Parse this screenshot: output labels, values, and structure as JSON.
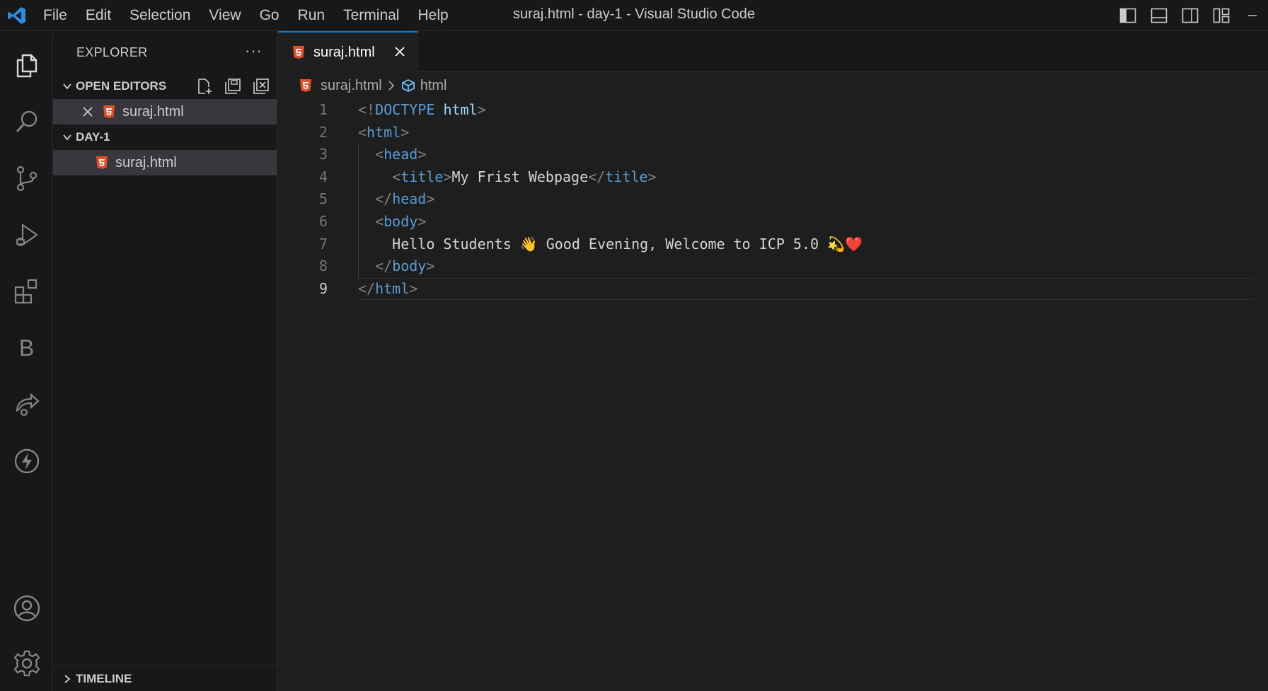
{
  "window": {
    "title": "suraj.html - day-1 - Visual Studio Code"
  },
  "menu": [
    "File",
    "Edit",
    "Selection",
    "View",
    "Go",
    "Run",
    "Terminal",
    "Help"
  ],
  "colors": {
    "accent": "#0078d4",
    "html_icon": "#e44d26",
    "tag": "#569cd6",
    "bracket": "#808080",
    "text": "#d4d4d4"
  },
  "activity_bar": {
    "top": [
      "files-icon",
      "search-icon",
      "source-control-icon",
      "run-debug-icon",
      "extensions-icon",
      "b-extension-icon",
      "live-share-icon",
      "thunder-client-icon"
    ],
    "bottom": [
      "account-icon",
      "settings-gear-icon"
    ],
    "b_label": "B"
  },
  "sidebar": {
    "title": "EXPLORER",
    "more": "···",
    "open_editors": {
      "label": "OPEN EDITORS",
      "items": [
        {
          "name": "suraj.html"
        }
      ]
    },
    "folder": {
      "label": "DAY-1",
      "items": [
        {
          "name": "suraj.html"
        }
      ]
    },
    "timeline": {
      "label": "TIMELINE"
    }
  },
  "editor": {
    "tab": {
      "label": "suraj.html"
    },
    "breadcrumb": {
      "file": "suraj.html",
      "symbol": "html"
    },
    "active_line": 9,
    "lines": [
      {
        "num": "1",
        "parts": [
          [
            "p",
            "<!"
          ],
          [
            "k",
            "DOCTYPE"
          ],
          [
            "w",
            " "
          ],
          [
            "a",
            "html"
          ],
          [
            "p",
            ">"
          ]
        ]
      },
      {
        "num": "2",
        "parts": [
          [
            "p",
            "<"
          ],
          [
            "t",
            "html"
          ],
          [
            "p",
            ">"
          ]
        ]
      },
      {
        "num": "3",
        "parts": [
          [
            "w",
            "  "
          ],
          [
            "p",
            "<"
          ],
          [
            "t",
            "head"
          ],
          [
            "p",
            ">"
          ]
        ]
      },
      {
        "num": "4",
        "parts": [
          [
            "w",
            "    "
          ],
          [
            "p",
            "<"
          ],
          [
            "t",
            "title"
          ],
          [
            "p",
            ">"
          ],
          [
            "w",
            "My Frist Webpage"
          ],
          [
            "p",
            "</"
          ],
          [
            "t",
            "title"
          ],
          [
            "p",
            ">"
          ]
        ]
      },
      {
        "num": "5",
        "parts": [
          [
            "w",
            "  "
          ],
          [
            "p",
            "</"
          ],
          [
            "t",
            "head"
          ],
          [
            "p",
            ">"
          ]
        ]
      },
      {
        "num": "6",
        "parts": [
          [
            "w",
            "  "
          ],
          [
            "p",
            "<"
          ],
          [
            "t",
            "body"
          ],
          [
            "p",
            ">"
          ]
        ]
      },
      {
        "num": "7",
        "parts": [
          [
            "w",
            "    Hello Students "
          ],
          [
            "e",
            "👋"
          ],
          [
            "w",
            " Good Evening, Welcome to ICP 5.0 "
          ],
          [
            "e",
            "💫"
          ],
          [
            "e",
            "❤️"
          ]
        ]
      },
      {
        "num": "8",
        "parts": [
          [
            "w",
            "  "
          ],
          [
            "p",
            "</"
          ],
          [
            "t",
            "body"
          ],
          [
            "p",
            ">"
          ]
        ]
      },
      {
        "num": "9",
        "parts": [
          [
            "p",
            "</"
          ],
          [
            "t",
            "html"
          ],
          [
            "p",
            ">"
          ]
        ]
      }
    ]
  }
}
